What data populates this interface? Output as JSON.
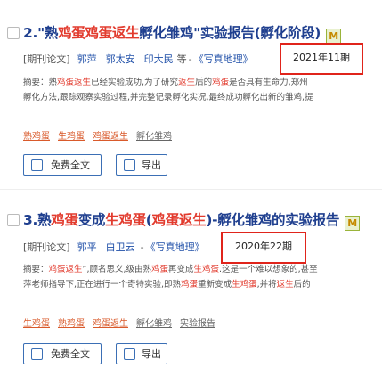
{
  "results": [
    {
      "title_prefix": "2.\"",
      "title_parts": [
        {
          "text": "熟",
          "hl": false
        },
        {
          "text": "鸡蛋鸡蛋返生",
          "hl": true
        },
        {
          "text": "孵化雏鸡\"实验报告(孵化阶段)",
          "hl": false
        }
      ],
      "badge": "M",
      "type": "[期刊论文]",
      "authors": [
        "郭萍",
        "郭太安",
        "印大民"
      ],
      "etc": "等",
      "journal": "《写真地理》",
      "date": "2021年11期",
      "abstract_line1_parts": [
        {
          "text": "摘要：熟",
          "hl": false
        },
        {
          "text": "鸡蛋返生",
          "hl": true
        },
        {
          "text": "已经实验成功,为了研究",
          "hl": false
        },
        {
          "text": "返生",
          "hl": true
        },
        {
          "text": "后的",
          "hl": false
        },
        {
          "text": "鸡蛋",
          "hl": true
        },
        {
          "text": "是否具有生命力,郑州",
          "hl": false
        }
      ],
      "abstract_line2": "孵化方法,跟踪观察实验过程,并完整记录孵化实况,最终成功孵化出新的雏鸡,提",
      "keywords": [
        {
          "text": "熟鸡蛋",
          "hl": true
        },
        {
          "text": "生鸡蛋",
          "hl": true
        },
        {
          "text": "鸡蛋返生",
          "hl": true
        },
        {
          "text": "孵化雏鸡",
          "hl": false
        }
      ],
      "btn_free": "免费全文",
      "btn_export": "导出"
    },
    {
      "title_prefix": "3.熟",
      "title_parts": [
        {
          "text": "鸡蛋",
          "hl": true
        },
        {
          "text": "变成",
          "hl": false
        },
        {
          "text": "生鸡蛋",
          "hl": true
        },
        {
          "text": "(",
          "hl": false
        },
        {
          "text": "鸡蛋返生",
          "hl": true
        },
        {
          "text": ")-孵化雏鸡的实验报告",
          "hl": false
        }
      ],
      "badge": "M",
      "type": "[期刊论文]",
      "authors": [
        "郭平",
        "白卫云"
      ],
      "etc": "",
      "journal": "《写真地理》",
      "date": "2020年22期",
      "abstract_line1_parts": [
        {
          "text": "摘要：",
          "hl": false
        },
        {
          "text": "鸡蛋返生",
          "hl": true
        },
        {
          "text": "”,顾名思义,级由熟",
          "hl": false
        },
        {
          "text": "鸡蛋",
          "hl": true
        },
        {
          "text": "再变成",
          "hl": false
        },
        {
          "text": "生鸡蛋",
          "hl": true
        },
        {
          "text": ".这是一个难以想象的,甚至",
          "hl": false
        }
      ],
      "abstract_line2_parts": [
        {
          "text": "萍老师指导下,正在进行一个奇特实验,即熟",
          "hl": false
        },
        {
          "text": "鸡蛋",
          "hl": true
        },
        {
          "text": "重新变成",
          "hl": false
        },
        {
          "text": "生鸡蛋",
          "hl": true
        },
        {
          "text": ",并将",
          "hl": false
        },
        {
          "text": "返生",
          "hl": true
        },
        {
          "text": "后的",
          "hl": false
        }
      ],
      "keywords": [
        {
          "text": "生鸡蛋",
          "hl": true
        },
        {
          "text": "熟鸡蛋",
          "hl": true
        },
        {
          "text": "鸡蛋返生",
          "hl": true
        },
        {
          "text": "孵化雏鸡",
          "hl": false
        },
        {
          "text": "实验报告",
          "hl": false
        }
      ],
      "btn_free": "免费全文",
      "btn_export": "导出"
    }
  ],
  "colors": {
    "highlight": "#e23b2e",
    "title": "#1f3f8f",
    "link": "#1f4fa8",
    "annotation_box": "#e0241b"
  }
}
